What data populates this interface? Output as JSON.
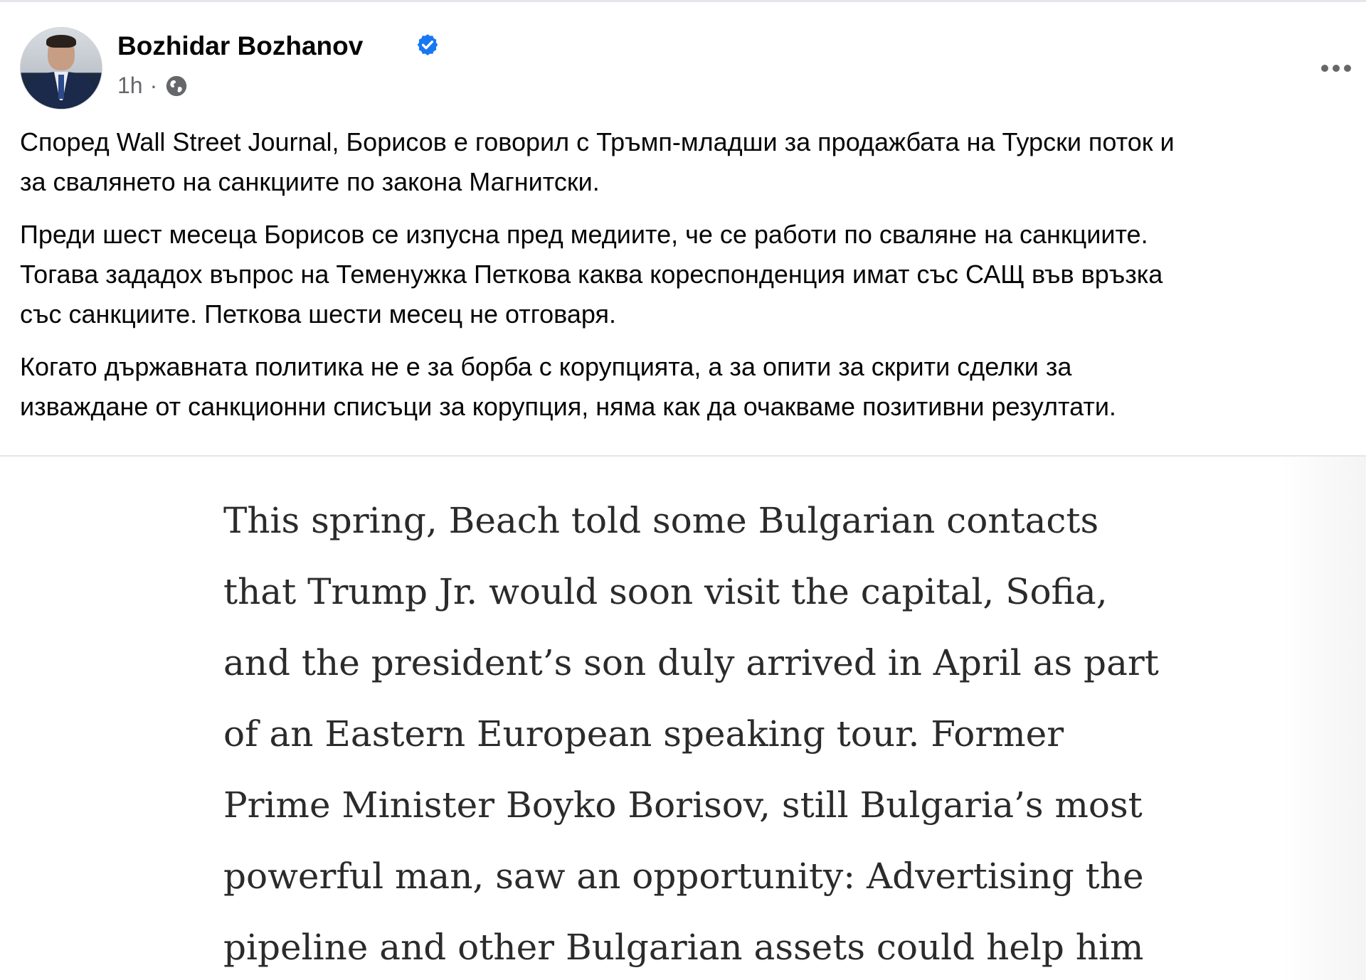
{
  "post": {
    "author": "Bozhidar Bozhanov",
    "verified_icon": "verified-badge-icon",
    "time": "1h",
    "separator": "·",
    "audience_icon": "globe-icon",
    "more_icon": "more-options-icon",
    "paragraphs": [
      "Според Wall Street Journal, Борисов е говорил с Тръмп-младши за продажбата на Турски поток и\nза свалянето на санкциите по закона Магнитски.",
      "Преди шест месеца Борисов се изпусна пред медиите, че се работи по сваляне на санкциите.\nТогава зададох въпрос на Теменужка Петкова каква кореспонденция имат със САЩ във връзка\nсъс санкциите. Петкова шести месец не отговаря.",
      "Когато държавната политика не е за борба с корупцията, а за опити за скрити сделки за\nизваждане от санкционни списъци за корупция, няма как да очакваме позитивни резултати."
    ]
  },
  "article_excerpt": {
    "lines": [
      "This spring, Beach told some Bulgarian contacts",
      "that Trump Jr. would soon visit the capital, Sofia,",
      "and the president’s son duly arrived in April as part",
      "of an Eastern European speaking tour. Former",
      "Prime Minister Boyko Borisov, still Bulgaria’s most",
      "powerful man, saw an opportunity: Advertising the",
      "pipeline and other Bulgarian assets could help him"
    ]
  },
  "colors": {
    "verified": "#1877f2",
    "meta": "#65676b",
    "text": "#050505",
    "article_text": "#2b2b2b"
  }
}
